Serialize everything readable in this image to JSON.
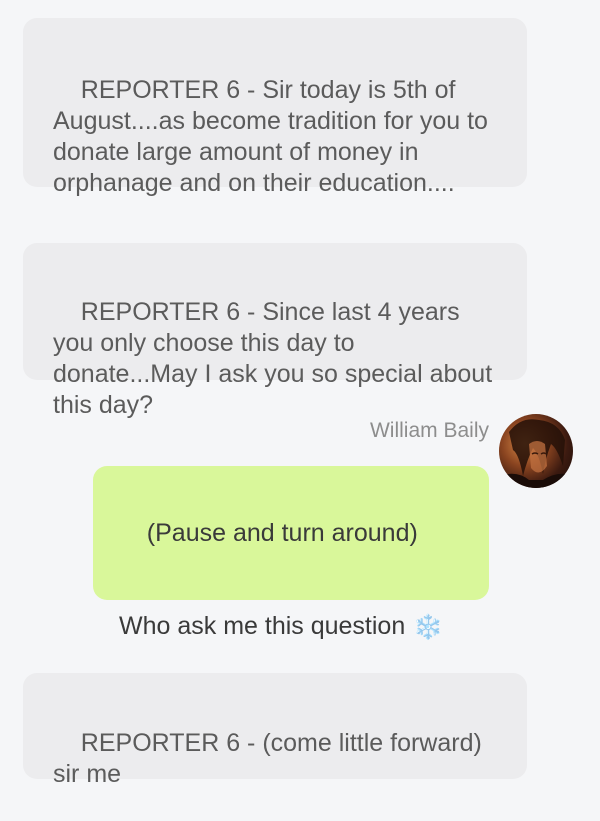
{
  "messages": [
    {
      "sender": "",
      "side": "left",
      "text": "REPORTER 6 - Sir today is 5th of August....as become tradition for you to donate large amount of money in orphanage and on their education...."
    },
    {
      "sender": "",
      "side": "left",
      "text": "REPORTER 6 - Since last 4 years you only choose this day to donate...May I ask you so special about this day?"
    },
    {
      "sender": "William Baily",
      "side": "right",
      "line1": "(Pause and turn around)",
      "line2": "Who ask me this question",
      "emoji": "❄️"
    },
    {
      "sender": "",
      "side": "left",
      "text": "REPORTER 6 - (come little forward) sir me"
    }
  ],
  "avatar": {
    "icon": "user-avatar-photo"
  },
  "colors": {
    "background": "#f5f6f8",
    "left_bubble": "#ececee",
    "right_bubble": "#d9f79a",
    "sender_name": "#8d8d8d"
  }
}
